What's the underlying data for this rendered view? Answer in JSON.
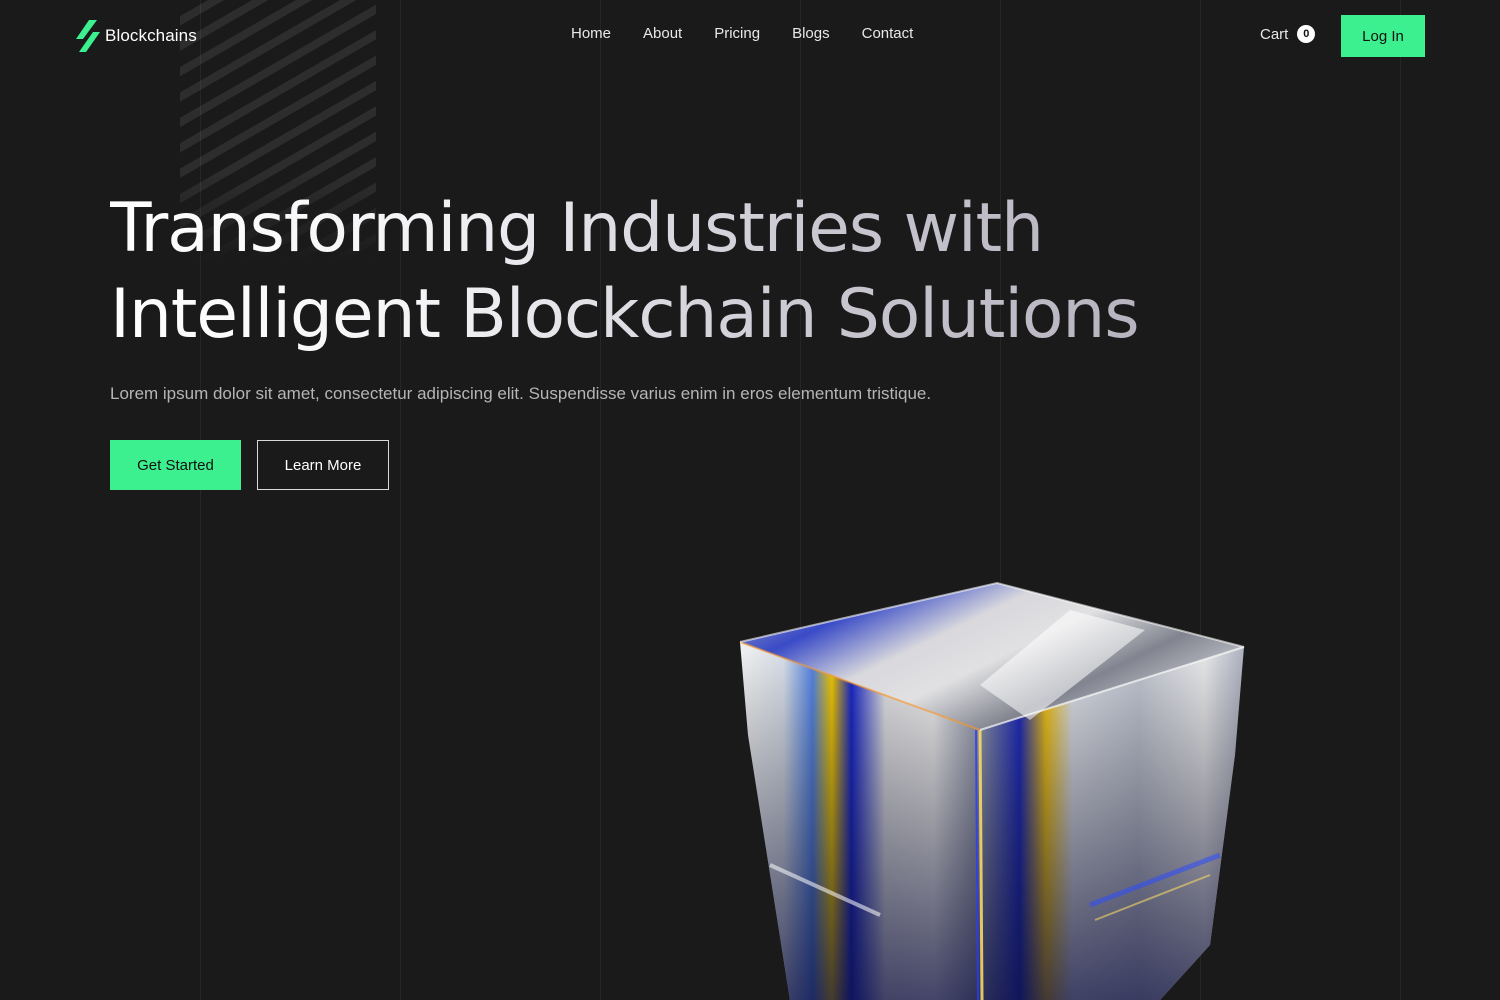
{
  "brand": {
    "name": "Blockchains",
    "logo_icon": "lightning-bolt-icon",
    "accent_color": "#3df08f",
    "background_color": "#1a1a1a"
  },
  "nav": {
    "links": [
      "Home",
      "About",
      "Pricing",
      "Blogs",
      "Contact"
    ],
    "cart_label": "Cart",
    "cart_count": "0",
    "login_label": "Log In"
  },
  "hero": {
    "title_line1": "Transforming Industries with",
    "title_line2": "Intelligent Blockchain Solutions",
    "subtitle": "Lorem ipsum dolor sit amet, consectetur adipiscing elit. Suspendisse varius enim in eros elementum tristique.",
    "primary_cta": "Get Started",
    "secondary_cta": "Learn More"
  }
}
